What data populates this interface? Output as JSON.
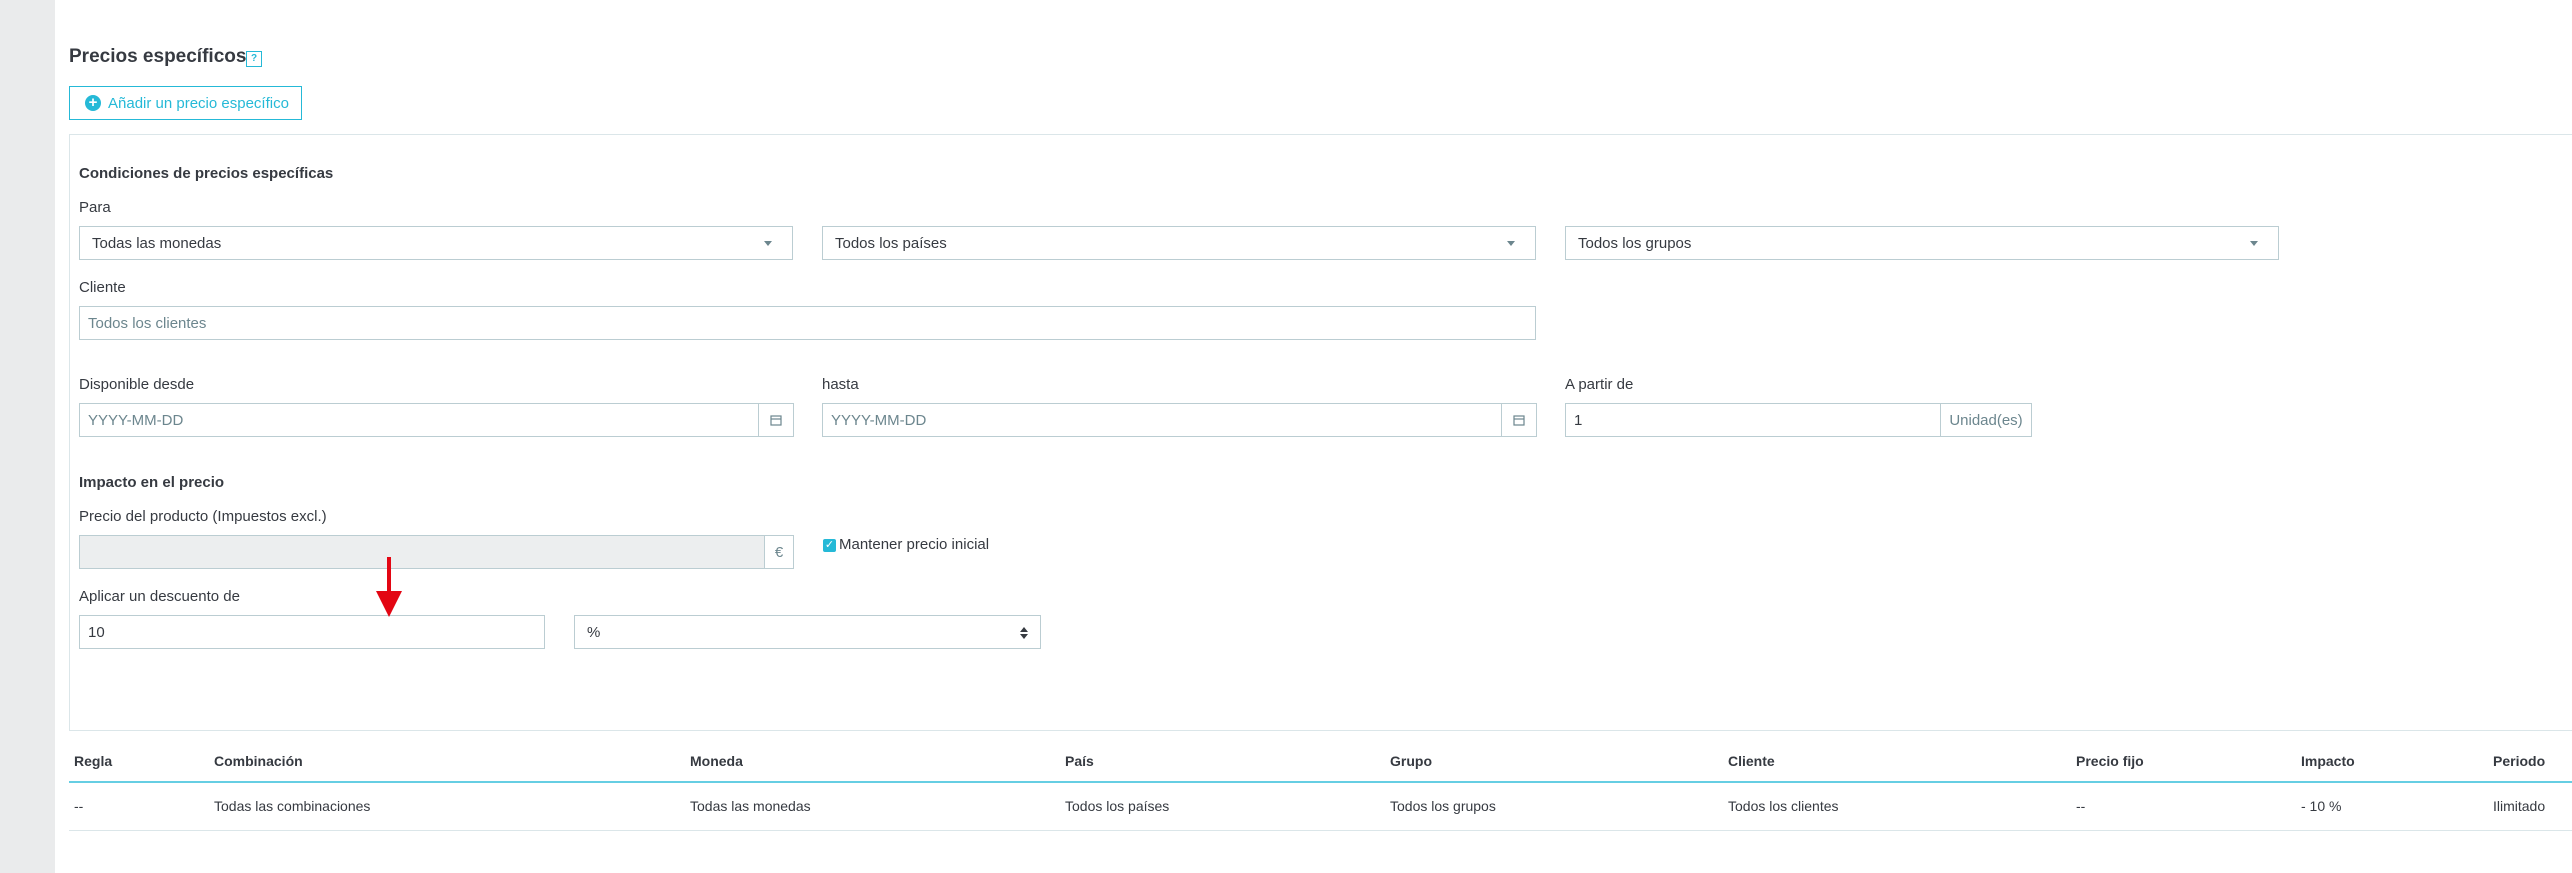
{
  "section": {
    "title": "Precios específicos",
    "help_icon": "?",
    "add_button_label": "Añadir un precio específico"
  },
  "conditions": {
    "heading": "Condiciones de precios específicas",
    "para_label": "Para",
    "currency_value": "Todas las monedas",
    "country_value": "Todos los países",
    "group_value": "Todos los grupos",
    "customer_label": "Cliente",
    "customer_placeholder": "Todos los clientes",
    "from_label": "Disponible desde",
    "from_placeholder": "YYYY-MM-DD",
    "to_label": "hasta",
    "to_placeholder": "YYYY-MM-DD",
    "starting_label": "A partir de",
    "starting_value": "1",
    "unit_label": "Unidad(es)"
  },
  "impact": {
    "heading": "Impacto en el precio",
    "price_label": "Precio del producto (Impuestos excl.)",
    "currency_symbol": "€",
    "keep_price_label": "Mantener precio inicial",
    "keep_price_checked": true,
    "discount_label": "Aplicar un descuento de",
    "discount_value": "10",
    "discount_type": "%"
  },
  "table": {
    "headers": [
      "Regla",
      "Combinación",
      "Moneda",
      "País",
      "Grupo",
      "Cliente",
      "Precio fijo",
      "Impacto",
      "Periodo"
    ],
    "rows": [
      [
        "--",
        "Todas las combinaciones",
        "Todas las monedas",
        "Todos los países",
        "Todos los grupos",
        "Todos los clientes",
        "--",
        "- 10 %",
        "Ilimitado"
      ]
    ]
  },
  "colors": {
    "accent": "#25b9d7",
    "arrow": "#e30613",
    "border": "#bbcdd2"
  }
}
